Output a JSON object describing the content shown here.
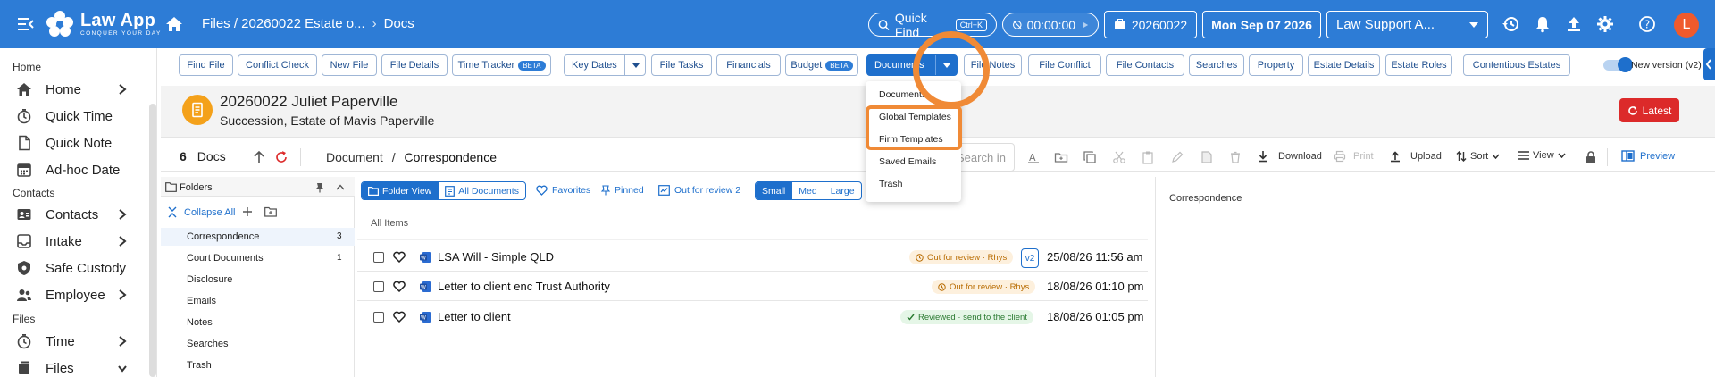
{
  "app": {
    "name": "Law App",
    "tagline": "CONQUER YOUR DAY"
  },
  "header": {
    "breadcrumb": [
      "Files / 20260022 Estate o...",
      "Docs"
    ],
    "quick_find": "Quick Find",
    "quick_find_shortcut": "Ctrl+K",
    "timer": "00:00:00",
    "file_button": "20260022",
    "date": "Mon Sep 07 2026",
    "role_select": "Law Support A...",
    "avatar": "L"
  },
  "sidebar": {
    "sections": [
      {
        "title": "Home",
        "items": [
          {
            "label": "Home",
            "icon": "home-icon",
            "chevron": true
          },
          {
            "label": "Quick Time",
            "icon": "stopwatch-icon",
            "chevron": false
          },
          {
            "label": "Quick Note",
            "icon": "note-icon",
            "chevron": false
          },
          {
            "label": "Ad-hoc Date",
            "icon": "calendar-icon",
            "chevron": false
          }
        ]
      },
      {
        "title": "Contacts",
        "items": [
          {
            "label": "Contacts",
            "icon": "contacts-icon",
            "chevron": true
          },
          {
            "label": "Intake",
            "icon": "intake-icon",
            "chevron": true
          },
          {
            "label": "Safe Custody",
            "icon": "safe-custody-icon",
            "chevron": false
          },
          {
            "label": "Employee",
            "icon": "employee-icon",
            "chevron": true
          }
        ]
      },
      {
        "title": "Files",
        "items": [
          {
            "label": "Time",
            "icon": "stopwatch-icon",
            "chevron": true
          },
          {
            "label": "Files",
            "icon": "files-icon",
            "chevron": true
          }
        ]
      }
    ]
  },
  "tabs": [
    {
      "label": "Find File"
    },
    {
      "label": "Conflict Check"
    },
    {
      "label": "New File"
    },
    {
      "label": "File Details"
    },
    {
      "label": "Time Tracker",
      "badge": "BETA"
    },
    {
      "label": "Key Dates"
    },
    {
      "label": "File Tasks"
    },
    {
      "label": "Financials"
    },
    {
      "label": "Budget",
      "badge": "BETA"
    },
    {
      "label": "Documents"
    },
    {
      "label": "File Notes"
    },
    {
      "label": "File Conflict"
    },
    {
      "label": "File Contacts"
    },
    {
      "label": "Searches"
    },
    {
      "label": "Property"
    },
    {
      "label": "Estate Details"
    },
    {
      "label": "Estate Roles"
    },
    {
      "label": "Contentious Estates"
    }
  ],
  "new_version_label": "New version (v2)",
  "matter": {
    "title": "20260022 Juliet Paperville",
    "subtitle": "Succession, Estate of Mavis Paperville",
    "latest_button": "Latest"
  },
  "docs_toolbar": {
    "count": "6",
    "label": "Docs",
    "breadcrumb": [
      "Document",
      "Correspondence"
    ],
    "search_placeholder": "Search in",
    "download": "Download",
    "print": "Print",
    "upload": "Upload",
    "sort": "Sort",
    "view": "View",
    "preview": "Preview"
  },
  "folders": {
    "title": "Folders",
    "collapse_all": "Collapse All",
    "items": [
      {
        "name": "Correspondence",
        "count": "3"
      },
      {
        "name": "Court Documents",
        "count": "1"
      },
      {
        "name": "Disclosure",
        "count": ""
      },
      {
        "name": "Emails",
        "count": ""
      },
      {
        "name": "Notes",
        "count": ""
      },
      {
        "name": "Searches",
        "count": ""
      },
      {
        "name": "Trash",
        "count": ""
      }
    ]
  },
  "list_toolbar": {
    "folder_view": "Folder View",
    "all_documents": "All Documents",
    "favorites": "Favorites",
    "pinned": "Pinned",
    "out_for_review": "Out for review 2",
    "sizes": [
      "Small",
      "Med",
      "Large"
    ]
  },
  "list": {
    "header": "All Items",
    "rows": [
      {
        "name": "LSA Will - Simple QLD",
        "status": "Out for review · Rhys",
        "status_type": "review",
        "version": "v2",
        "date": "25/08/26 11:56 am"
      },
      {
        "name": "Letter to client enc Trust Authority",
        "status": "Out for review · Rhys",
        "status_type": "review",
        "version": "",
        "date": "18/08/26 01:10 pm"
      },
      {
        "name": "Letter to client",
        "status": "Reviewed · send to the client",
        "status_type": "done",
        "version": "",
        "date": "18/08/26 01:05 pm"
      }
    ]
  },
  "preview_panel": {
    "title": "Correspondence"
  },
  "documents_menu": {
    "items": [
      "Documents",
      "Global Templates",
      "Firm Templates",
      "Saved Emails",
      "Trash"
    ]
  },
  "colors": {
    "primary": "#2d7cd6",
    "accent": "#1e6fcc",
    "highlight": "#f08a36",
    "danger": "#dc2a2a"
  }
}
